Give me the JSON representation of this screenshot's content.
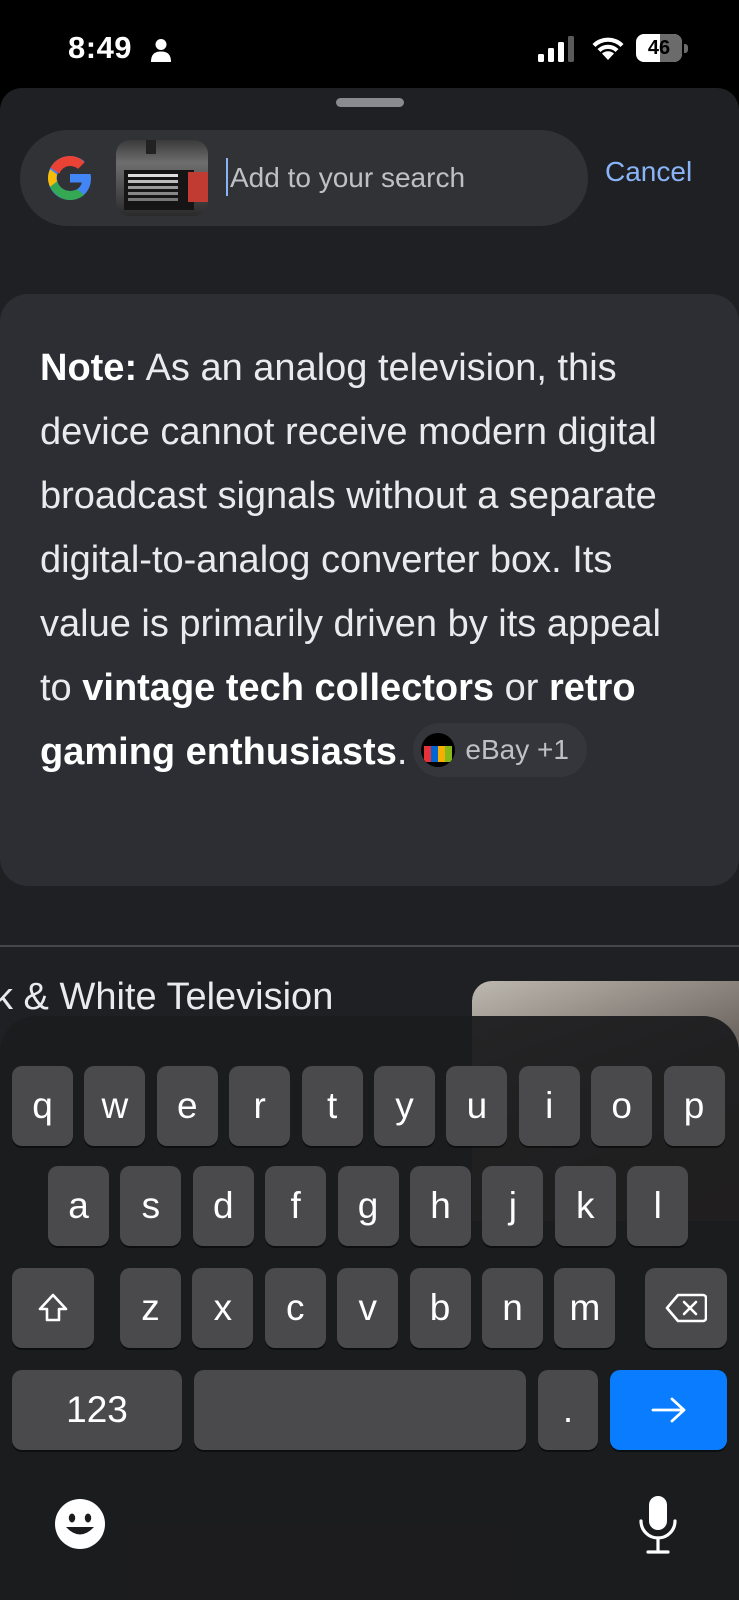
{
  "status_bar": {
    "time": "8:49",
    "battery": "46"
  },
  "search": {
    "placeholder": "Add to your search",
    "cancel_label": "Cancel",
    "logo": "google-logo",
    "thumbnail": "captured-image-thumbnail"
  },
  "note": {
    "lead": "Note:",
    "text1": " As an analog television, this device cannot receive modern digital broadcast signals without a separate digital-to-analog converter box. Its value is primarily driven by its appeal to ",
    "bold1": "vintage tech collectors",
    "text2": " or ",
    "bold2": "retro gaming enthusiasts",
    "text3": ".",
    "source_label": "eBay +1"
  },
  "result": {
    "title": "k & White Television"
  },
  "keyboard": {
    "row1": [
      "q",
      "w",
      "e",
      "r",
      "t",
      "y",
      "u",
      "i",
      "o",
      "p"
    ],
    "row2": [
      "a",
      "s",
      "d",
      "f",
      "g",
      "h",
      "j",
      "k",
      "l"
    ],
    "row3": [
      "z",
      "x",
      "c",
      "v",
      "b",
      "n",
      "m"
    ],
    "numbers_label": "123",
    "period_label": ".",
    "shift_icon": "shift-icon",
    "delete_icon": "backspace-icon",
    "go_icon": "arrow-right-icon",
    "emoji_icon": "emoji-icon",
    "mic_icon": "microphone-icon"
  },
  "colors": {
    "accent": "#8ab4f8",
    "go_key": "#0a7cff",
    "card": "#2c2e33",
    "sheet": "#1f2024"
  }
}
